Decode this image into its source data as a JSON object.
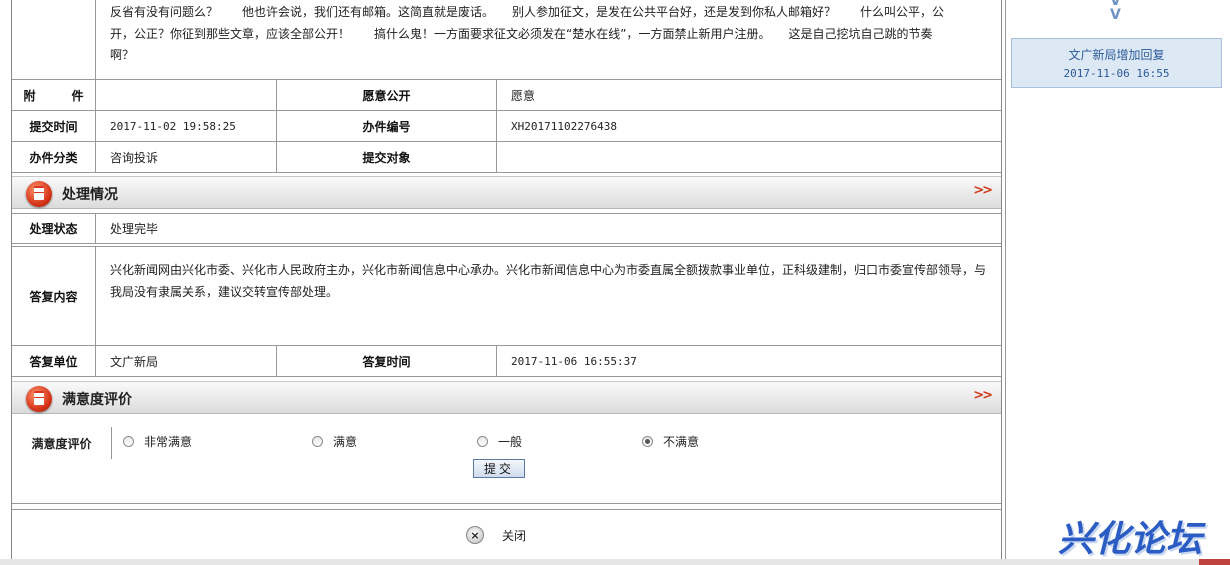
{
  "description": {
    "lines": [
      "反省有没有问题么？　　他也许会说，我们还有邮箱。这简直就是废话。　　别人参加征文，是发在公共平台好，还是发到你私人邮箱好？　　什么叫公平，公",
      "开，公正？你征到那些文章，应该全部公开！　　搞什么鬼！一方面要求征文必须发在“楚水在线”，一方面禁止新用户注册。　　这是自己挖坑自己跳的节奏",
      "啊？"
    ]
  },
  "info": {
    "attachment_label": "附　　　件",
    "attachment_value": "",
    "public_label": "愿意公开",
    "public_value": "愿意",
    "submit_time_label": "提交时间",
    "submit_time_value": "2017-11-02 19:58:25",
    "case_no_label": "办件编号",
    "case_no_value": "XH20171102276438",
    "category_label": "办件分类",
    "category_value": "咨询投诉",
    "target_label": "提交对象",
    "target_value": ""
  },
  "processing": {
    "section_title": "处理情况",
    "more_icon": "double-chevron-right",
    "status_label": "处理状态",
    "status_value": "处理完毕",
    "reply_label": "答复内容",
    "reply_lines": [
      "兴化新闻网由兴化市委、兴化市人民政府主办，兴化市新闻信息中心承办。兴化市新闻信息中心为市委直属全额拨款事业单位，正科级建制，归口市委宣传部领导，与",
      "我局没有隶属关系，建议交转宣传部处理。"
    ],
    "unit_label": "答复单位",
    "unit_value": "文广新局",
    "reply_time_label": "答复时间",
    "reply_time_value": "2017-11-06 16:55:37"
  },
  "satisfaction": {
    "section_title": "满意度评价",
    "label": "满意度评价",
    "options": [
      "非常满意",
      "满意",
      "一般",
      "不满意"
    ],
    "selected": "不满意",
    "submit_label": "提交"
  },
  "close": {
    "label": "关闭"
  },
  "sidebar": {
    "reply_title": "文广新局增加回复",
    "reply_time": "2017-11-06 16:55"
  },
  "logo": {
    "text": "兴化论坛"
  },
  "colors": {
    "accent_red": "#d03a18",
    "link_blue": "#2c5a99",
    "logo_blue": "#2a5cc4"
  }
}
